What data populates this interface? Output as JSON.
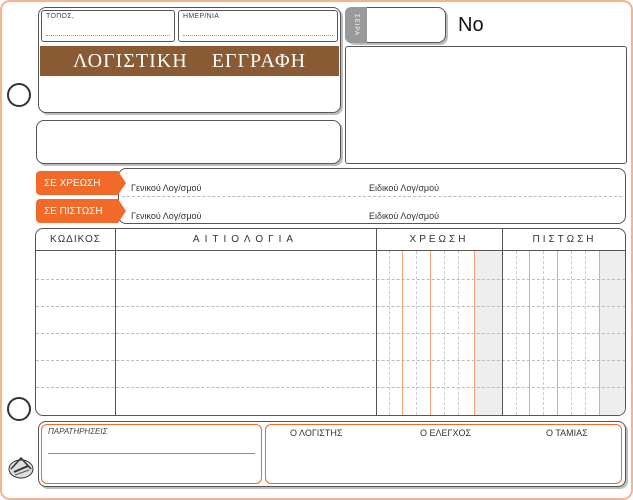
{
  "header": {
    "place_label": "ΤΟΠΟΣ,",
    "date_label": "ΗΜΕΡ/ΝΙΑ",
    "title_word1": "ΛΟΓΙΣΤΙΚΗ",
    "title_word2": "ΕΓΓΡΑΦΗ",
    "series_label": "ΣΕΙΡΑ",
    "number_label": "No"
  },
  "accounts": {
    "debit_tag": "ΣΕ ΧΡΕΩΣΗ",
    "credit_tag": "ΣΕ ΠΙΣΤΩΣΗ",
    "general_account": "Γενικού Λογ/σμού",
    "specific_account": "Ειδικού Λογ/σμού"
  },
  "table": {
    "columns": [
      "ΚΩΔΙΚΟΣ",
      "ΑΙΤΙΟΛΟΓΙΑ",
      "ΧΡΕΩΣΗ",
      "ΠΙΣΤΩΣΗ"
    ]
  },
  "footer": {
    "remarks_label": "ΠΑΡΑΤΗΡΗΣΕΙΣ",
    "accountant": "Ο ΛΟΓΙΣΤΗΣ",
    "controller": "Ο ΕΛΕΓΧΟΣ",
    "cashier": "Ο ΤΑΜΙΑΣ"
  },
  "colors": {
    "accent": "#f26a2a",
    "title_band": "#8a5a32",
    "border": "#f6b48e"
  }
}
